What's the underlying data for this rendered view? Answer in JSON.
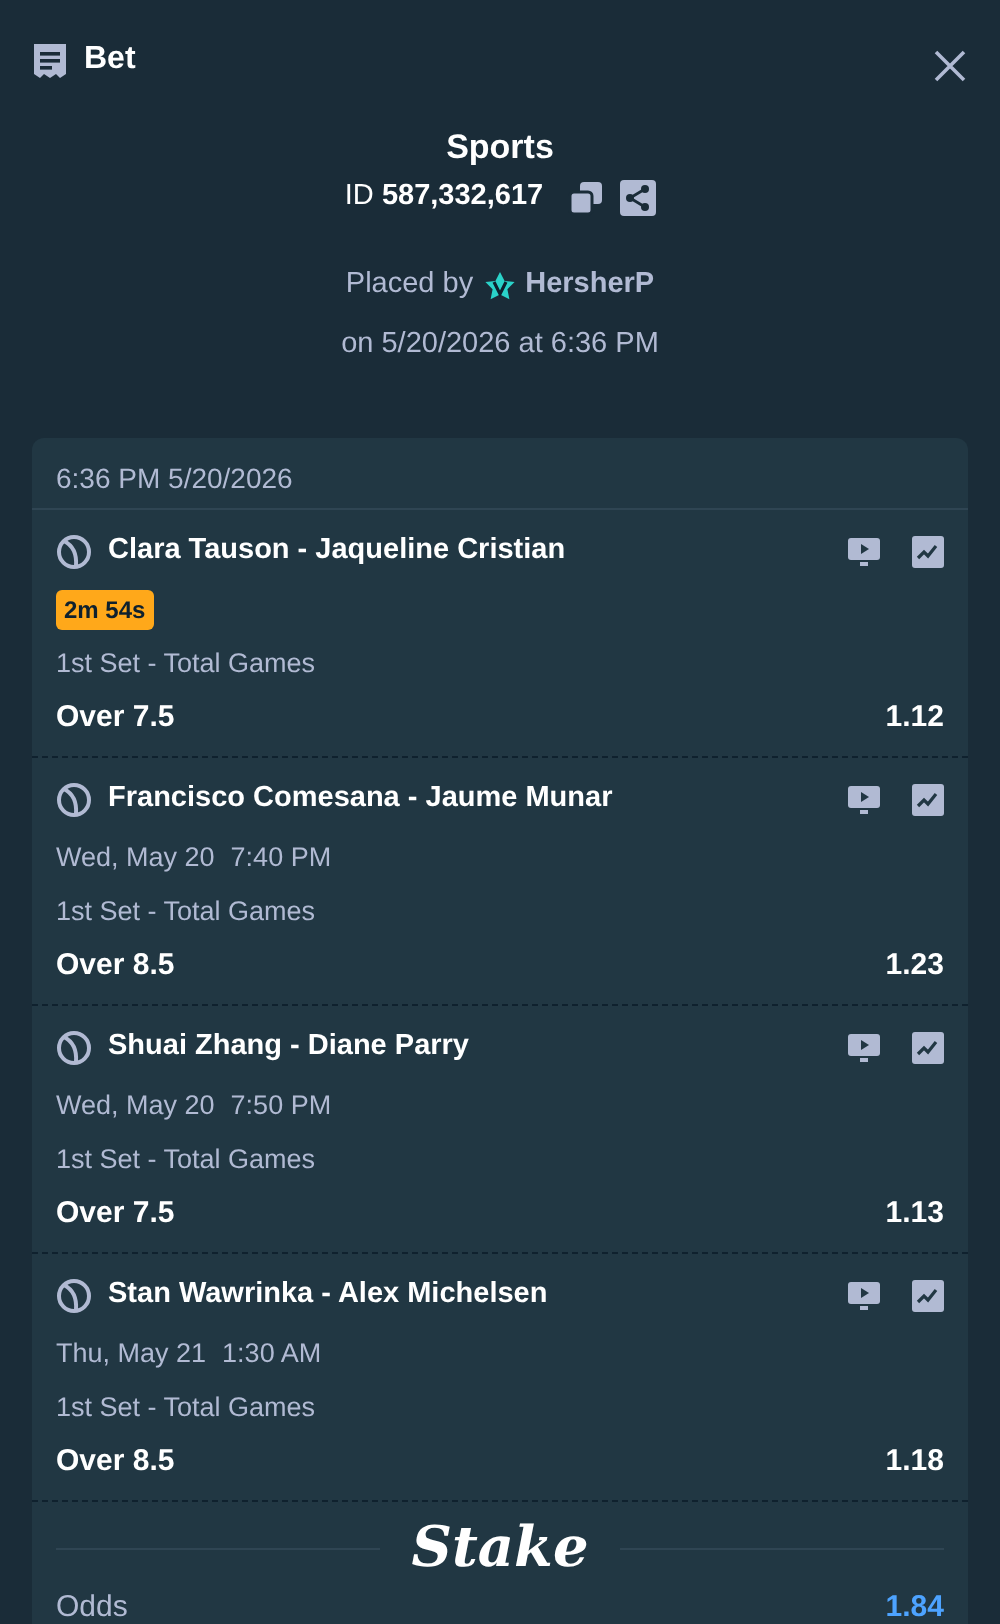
{
  "header": {
    "title": "Bet"
  },
  "bet": {
    "category": "Sports",
    "id_label": "ID",
    "id_value": "587,332,617",
    "placed_by_label": "Placed by",
    "user": "HersherP",
    "placed_on": "on 5/20/2026 at 6:36 PM"
  },
  "slip": {
    "timestamp": "6:36 PM 5/20/2026",
    "legs": [
      {
        "match": "Clara Tauson - Jaqueline Cristian",
        "kind": "live",
        "timer": "2m 54s",
        "market": "1st Set - Total Games",
        "selection": "Over 7.5",
        "odds": "1.12"
      },
      {
        "match": "Francisco Comesana - Jaume Munar",
        "kind": "scheduled",
        "date": "Wed, May 20",
        "time": "7:40 PM",
        "market": "1st Set - Total Games",
        "selection": "Over 8.5",
        "odds": "1.23"
      },
      {
        "match": "Shuai Zhang - Diane Parry",
        "kind": "scheduled",
        "date": "Wed, May 20",
        "time": "7:50 PM",
        "market": "1st Set - Total Games",
        "selection": "Over 7.5",
        "odds": "1.13"
      },
      {
        "match": "Stan Wawrinka - Alex Michelsen",
        "kind": "scheduled",
        "date": "Thu, May 21",
        "time": "1:30 AM",
        "market": "1st Set - Total Games",
        "selection": "Over 8.5",
        "odds": "1.18"
      }
    ],
    "brand": "Stake",
    "summary": [
      {
        "label": "Odds",
        "value": "1.84"
      }
    ]
  }
}
